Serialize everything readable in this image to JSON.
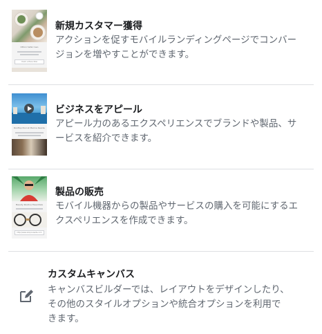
{
  "items": [
    {
      "title": "新規カスタマー獲得",
      "desc": "アクションを促すモバイルランディングページでコンバージョンを増やすことができます。",
      "thumb_caption": "Ottoni Safari Geo",
      "thumb_button": "Claim a Place Now"
    },
    {
      "title": "ビジネスをアピール",
      "desc": "アピール力のあるエクスペリエンスでブランドや製品、サービスを紹介できます。",
      "thumb_caption": "Rooftop Pool at Marina Residences"
    },
    {
      "title": "製品の販売",
      "desc": "モバイル機器からの製品やサービスの購入を可能にするエクスペリエンスを作成できます。",
      "thumb_caption": "Beauty Routine Essentials",
      "thumb_button": "http://www.shopnowsite.com"
    },
    {
      "title": "カスタムキャンバス",
      "desc": "キャンバスビルダーでは、レイアウトをデザインしたり、その他のスタイルオプションや統合オプションを利用できます。",
      "icon": "edit-icon"
    }
  ],
  "colors": {
    "title": "#1c1e21",
    "desc": "#606770",
    "divider": "#dddfe2",
    "icon": "#606770"
  }
}
